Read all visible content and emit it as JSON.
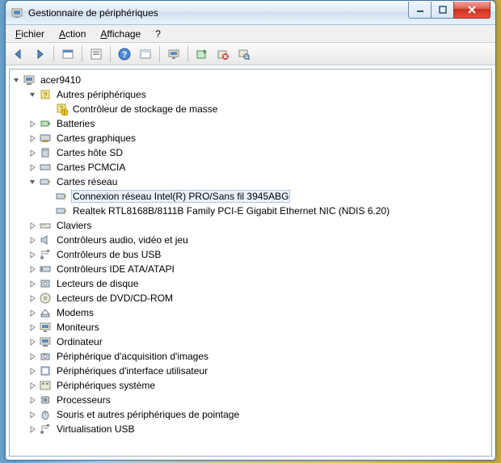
{
  "window": {
    "title": "Gestionnaire de périphériques"
  },
  "menu": {
    "file": "Fichier",
    "action": "Action",
    "view": "Affichage",
    "help": "?"
  },
  "toolbar_icons": {
    "back": "back-icon",
    "forward": "forward-icon",
    "up": "up-icon",
    "show_hide": "show-hide-icon",
    "help": "help-icon",
    "view": "view-icon",
    "monitor": "monitor-icon",
    "update": "update-icon",
    "uninstall": "uninstall-icon",
    "scan": "scan-icon"
  },
  "tree": {
    "root": "acer9410",
    "other_devices": {
      "label": "Autres périphériques",
      "child": "Contrôleur de stockage de masse"
    },
    "batteries": "Batteries",
    "graphics": "Cartes graphiques",
    "sd_host": "Cartes hôte SD",
    "pcmcia": "Cartes PCMCIA",
    "network": {
      "label": "Cartes réseau",
      "wifi": "Connexion réseau Intel(R) PRO/Sans fil 3945ABG",
      "ethernet": "Realtek RTL8168B/8111B Family PCI-E Gigabit Ethernet NIC (NDIS 6.20)"
    },
    "keyboards": "Claviers",
    "audio": "Contrôleurs audio, vidéo et jeu",
    "usb": "Contrôleurs de bus USB",
    "ide": "Contrôleurs IDE ATA/ATAPI",
    "disk": "Lecteurs de disque",
    "dvd": "Lecteurs de DVD/CD-ROM",
    "modems": "Modems",
    "monitors": "Moniteurs",
    "computer": "Ordinateur",
    "imaging": "Périphérique d'acquisition d'images",
    "hid": "Périphériques d'interface utilisateur",
    "system": "Périphériques système",
    "cpu": "Processeurs",
    "mouse": "Souris et autres périphériques de pointage",
    "virtual_usb": "Virtualisation USB"
  }
}
